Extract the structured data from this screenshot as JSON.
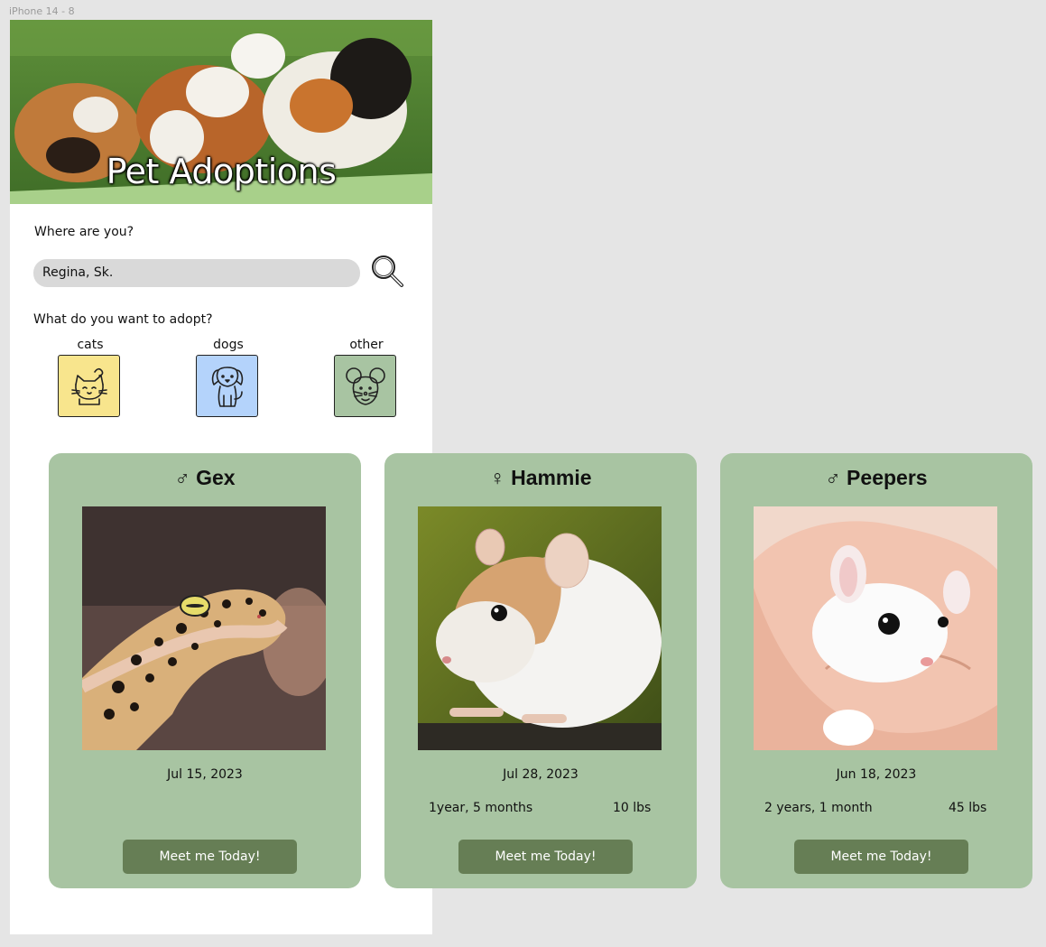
{
  "frame_label": "iPhone 14 - 8",
  "header": {
    "title": "Pet Adoptions"
  },
  "location": {
    "question": "Where are you?",
    "value": "Regina, Sk.",
    "search_icon": "magnifier-icon"
  },
  "adopt": {
    "question": "What do you want to adopt?",
    "categories": [
      {
        "label": "cats",
        "icon": "cat-icon",
        "color": "#f8e58d"
      },
      {
        "label": "dogs",
        "icon": "dog-icon",
        "color": "#b4d3fb"
      },
      {
        "label": "other",
        "icon": "mouse-icon",
        "color": "#a8c4a2"
      }
    ]
  },
  "pets": [
    {
      "sex_symbol": "♂",
      "name": "Gex",
      "title": "♂ Gex",
      "date": "Jul 15, 2023",
      "age": "",
      "weight": "",
      "button": "Meet me Today!"
    },
    {
      "sex_symbol": "♀",
      "name": "Hammie",
      "title": "♀ Hammie",
      "date": "Jul 28, 2023",
      "age": "1year, 5 months",
      "weight": "10 lbs",
      "button": "Meet me Today!"
    },
    {
      "sex_symbol": "♂",
      "name": "Peepers",
      "title": "♂ Peepers",
      "date": "Jun 18, 2023",
      "age": "2 years, 1 month",
      "weight": "45 lbs",
      "button": "Meet me Today!"
    }
  ],
  "colors": {
    "card_bg": "#a8c4a2",
    "button_bg": "#667e55",
    "input_bg": "#d9d9d9"
  }
}
